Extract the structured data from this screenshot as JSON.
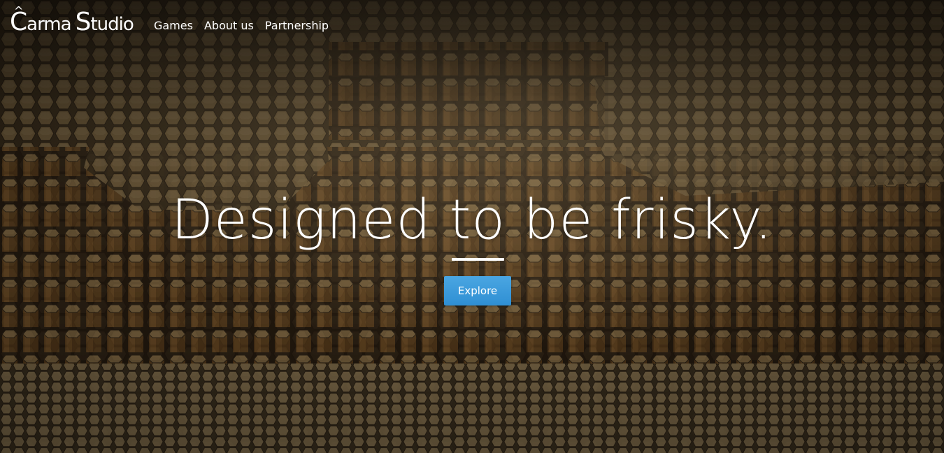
{
  "brand": {
    "logo_text": "Carma Studio",
    "logo_c": "C",
    "logo_hat": "^",
    "logo_arma": "arma",
    "logo_s": "S",
    "logo_tudio": "tudio"
  },
  "nav": {
    "items": [
      {
        "label": "Games"
      },
      {
        "label": "About us"
      },
      {
        "label": "Partnership"
      }
    ]
  },
  "hero": {
    "headline": "Designed to be frisky.",
    "cta_label": "Explore",
    "background": "hexagonal-pillars-image"
  },
  "colors": {
    "accent": "#3598dc",
    "text": "#ffffff",
    "background": "#5b4a2c"
  }
}
